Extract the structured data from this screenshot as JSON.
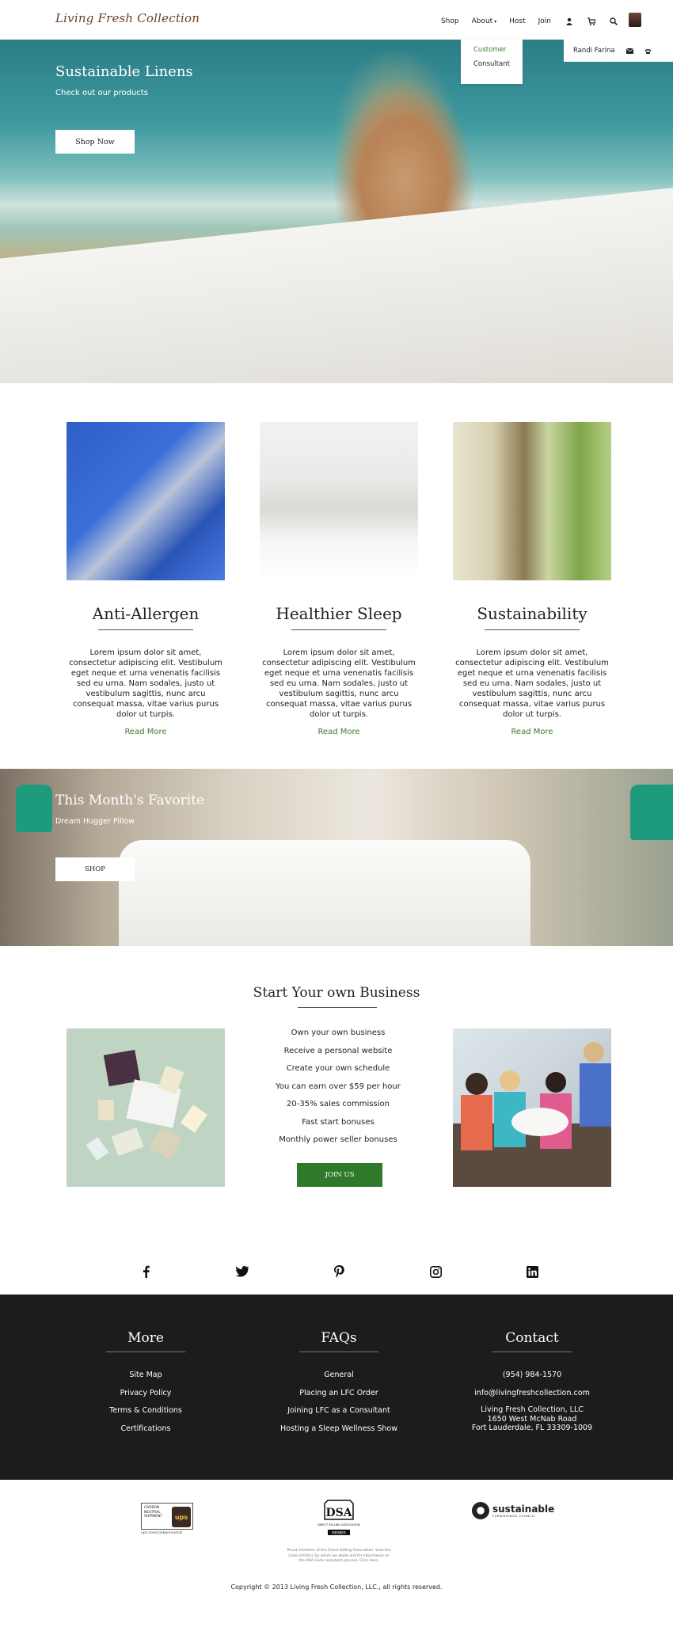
{
  "header": {
    "logo": "Living Fresh Collection",
    "nav": [
      "Shop",
      "About",
      "Host",
      "Join"
    ],
    "dropdown": [
      "Customer",
      "Consultant"
    ],
    "user_name": "Randi Farina"
  },
  "hero": {
    "title": "Sustainable Linens",
    "subtitle": "Check out our products",
    "button": "Shop Now"
  },
  "features": [
    {
      "title": "Anti-Allergen",
      "body": "Lorem ipsum dolor sit amet, consectetur adipiscing elit. Vestibulum eget neque et urna venenatis facilisis sed eu urna. Nam sodales, justo ut vestibulum sagittis, nunc arcu consequat massa, vitae varius purus dolor ut turpis.",
      "link": "Read More"
    },
    {
      "title": "Healthier Sleep",
      "body": "Lorem ipsum dolor sit amet, consectetur adipiscing elit. Vestibulum eget neque et urna venenatis facilisis sed eu urna. Nam sodales, justo ut vestibulum sagittis, nunc arcu consequat massa, vitae varius purus dolor ut turpis.",
      "link": "Read More"
    },
    {
      "title": "Sustainability",
      "body": "Lorem ipsum dolor sit amet, consectetur adipiscing elit. Vestibulum eget neque et urna venenatis facilisis sed eu urna. Nam sodales, justo ut vestibulum sagittis, nunc arcu consequat massa, vitae varius purus dolor ut turpis.",
      "link": "Read More"
    }
  ],
  "favorite": {
    "title": "This Month's Favorite",
    "subtitle": "Dream Hugger Pillow",
    "button": "SHOP"
  },
  "business": {
    "title": "Start Your own Business",
    "items": [
      "Own your own business",
      "Receive a personal website",
      "Create your own schedule",
      "You can earn over $59 per hour",
      "20-35% sales commission",
      "Fast start bonuses",
      "Monthly power seller bonuses"
    ],
    "button": "JOIN US"
  },
  "social": [
    "facebook-icon",
    "twitter-icon",
    "pinterest-icon",
    "instagram-icon",
    "linkedin-icon"
  ],
  "footer": {
    "more": {
      "title": "More",
      "links": [
        "Site Map",
        "Privacy Policy",
        "Terms & Conditions",
        "Certifications"
      ]
    },
    "faqs": {
      "title": "FAQs",
      "links": [
        "General",
        "Placing an LFC Order",
        "Joining LFC as a Consultant",
        "Hosting a Sleep Wellness Show"
      ]
    },
    "contact": {
      "title": "Contact",
      "phone": "(954) 984-1570",
      "email": "info@livingfreshcollection.com",
      "address": [
        "Living Fresh Collection, LLC",
        "1650 West McNab Road",
        "Fort Lauderdale, FL 33309-1009"
      ]
    }
  },
  "badges": {
    "ups_text": [
      "CARBON",
      "NEUTRAL",
      "SHIPMENT"
    ],
    "ups_mark": "ups",
    "ups_link": "ups.com/carbonneutral",
    "dsa_mark": "DSA",
    "dsa_sub": "DIRECT SELLING ASSOCIATION",
    "dsa_member": "MEMBER",
    "dsa_note": "Proud members of the Direct Selling Association. View the Code of Ethics by which we abide and for information on the DSA Code complaint process. Click Here.",
    "sust_a": "sustainable",
    "sust_b": "FURNISHINGS COUNCIL"
  },
  "copyright": "Copyright © 2013 Living Fresh Collection, LLC., all rights reserved."
}
